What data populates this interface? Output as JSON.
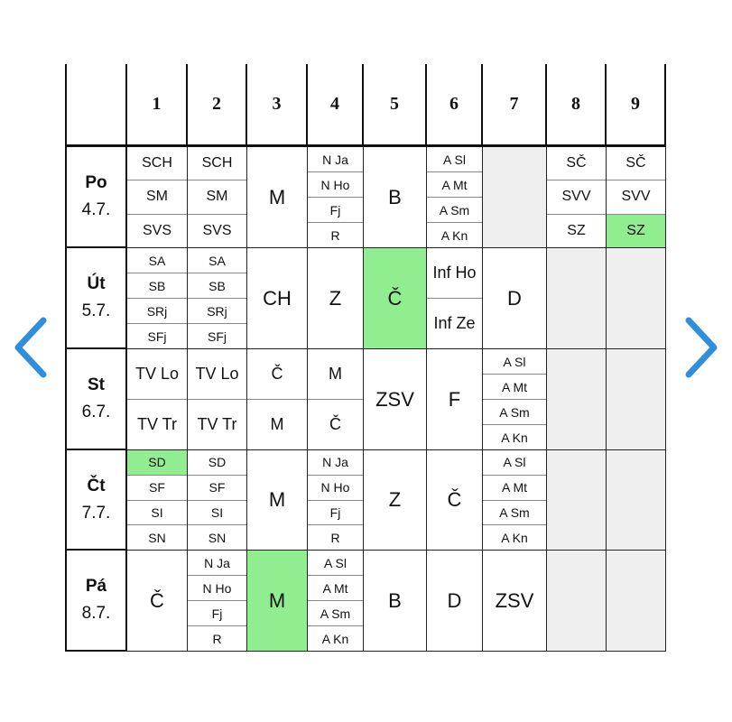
{
  "periods": [
    "1",
    "2",
    "3",
    "4",
    "5",
    "6",
    "7",
    "8",
    "9"
  ],
  "days": [
    {
      "name": "Po",
      "date": "4.7."
    },
    {
      "name": "Út",
      "date": "5.7."
    },
    {
      "name": "St",
      "date": "6.7."
    },
    {
      "name": "Čt",
      "date": "7.7."
    },
    {
      "name": "Pá",
      "date": "8.7."
    }
  ],
  "cells": [
    [
      {
        "items": [
          "SCH",
          "SM",
          "SVS"
        ]
      },
      {
        "items": [
          "SCH",
          "SM",
          "SVS"
        ]
      },
      {
        "items": [
          "M"
        ]
      },
      {
        "items": [
          "N Ja",
          "N Ho",
          "Fj",
          "R"
        ]
      },
      {
        "items": [
          "B"
        ]
      },
      {
        "items": [
          "A Sl",
          "A Mt",
          "A Sm",
          "A Kn"
        ]
      },
      {
        "items": [],
        "empty": true
      },
      {
        "items": [
          "SČ",
          "SVV",
          "SZ"
        ]
      },
      {
        "items": [
          "SČ",
          "SVV",
          "SZ"
        ],
        "highlight_index": 2
      }
    ],
    [
      {
        "items": [
          "SA",
          "SB",
          "SRj",
          "SFj"
        ]
      },
      {
        "items": [
          "SA",
          "SB",
          "SRj",
          "SFj"
        ]
      },
      {
        "items": [
          "CH"
        ]
      },
      {
        "items": [
          "Z"
        ]
      },
      {
        "items": [
          "Č"
        ],
        "highlight": true
      },
      {
        "items": [
          "Inf Ho",
          "Inf Ze"
        ]
      },
      {
        "items": [
          "D"
        ]
      },
      {
        "items": [],
        "empty": true
      },
      {
        "items": [],
        "empty": true
      }
    ],
    [
      {
        "items": [
          "TV Lo",
          "TV Tr"
        ]
      },
      {
        "items": [
          "TV Lo",
          "TV Tr"
        ]
      },
      {
        "items": [
          "Č",
          "M"
        ]
      },
      {
        "items": [
          "M",
          "Č"
        ]
      },
      {
        "items": [
          "ZSV"
        ]
      },
      {
        "items": [
          "F"
        ]
      },
      {
        "items": [
          "A Sl",
          "A Mt",
          "A Sm",
          "A Kn"
        ]
      },
      {
        "items": [],
        "empty": true
      },
      {
        "items": [],
        "empty": true
      }
    ],
    [
      {
        "items": [
          "SD",
          "SF",
          "SI",
          "SN"
        ],
        "highlight_index": 0
      },
      {
        "items": [
          "SD",
          "SF",
          "SI",
          "SN"
        ]
      },
      {
        "items": [
          "M"
        ]
      },
      {
        "items": [
          "N Ja",
          "N Ho",
          "Fj",
          "R"
        ]
      },
      {
        "items": [
          "Z"
        ]
      },
      {
        "items": [
          "Č"
        ]
      },
      {
        "items": [
          "A Sl",
          "A Mt",
          "A Sm",
          "A Kn"
        ]
      },
      {
        "items": [],
        "empty": true
      },
      {
        "items": [],
        "empty": true
      }
    ],
    [
      {
        "items": [
          "Č"
        ]
      },
      {
        "items": [
          "N Ja",
          "N Ho",
          "Fj",
          "R"
        ]
      },
      {
        "items": [
          "M"
        ],
        "highlight": true
      },
      {
        "items": [
          "A Sl",
          "A Mt",
          "A Sm",
          "A Kn"
        ]
      },
      {
        "items": [
          "B"
        ]
      },
      {
        "items": [
          "D"
        ]
      },
      {
        "items": [
          "ZSV"
        ]
      },
      {
        "items": [],
        "empty": true
      },
      {
        "items": [],
        "empty": true
      }
    ]
  ],
  "nav": {
    "prev_icon": "chevron-left-icon",
    "next_icon": "chevron-right-icon"
  },
  "colors": {
    "highlight": "#90ee90",
    "empty": "#efefef",
    "arrow": "#2f8fdc"
  }
}
